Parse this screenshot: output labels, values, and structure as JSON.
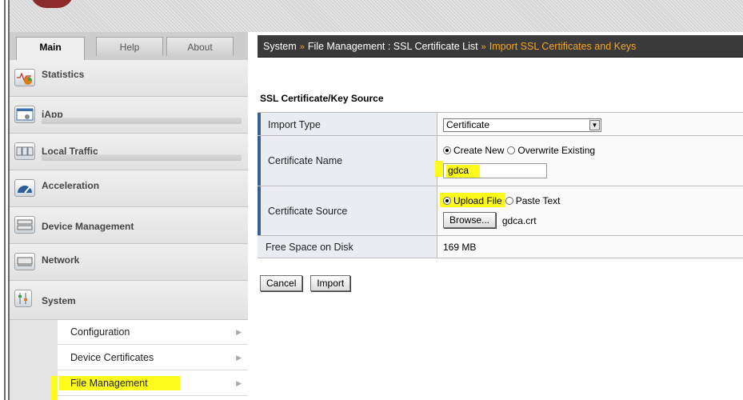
{
  "sidebar": {
    "tabs": [
      "Main",
      "Help",
      "About"
    ],
    "items": [
      {
        "label": "Statistics",
        "icon": "statistics-icon"
      },
      {
        "label": "iApp",
        "icon": "iapp-icon"
      },
      {
        "label": "Local Traffic",
        "icon": "local-traffic-icon"
      },
      {
        "label": "Acceleration",
        "icon": "acceleration-icon"
      },
      {
        "label": "Device Management",
        "icon": "device-management-icon"
      },
      {
        "label": "Network",
        "icon": "network-icon"
      },
      {
        "label": "System",
        "icon": "system-icon"
      }
    ],
    "submenu": [
      "Configuration",
      "Device Certificates",
      "File Management"
    ]
  },
  "breadcrumb": {
    "system": "System",
    "file_management": "File Management : SSL Certificate List",
    "current": "Import SSL Certificates and Keys",
    "separator": "»"
  },
  "form": {
    "section_title": "SSL Certificate/Key Source",
    "import_type_label": "Import Type",
    "import_type_value": "Certificate",
    "cert_name_label": "Certificate Name",
    "create_new": "Create New",
    "overwrite_existing": "Overwrite Existing",
    "cert_name_value": "gdca",
    "cert_source_label": "Certificate Source",
    "upload_file": "Upload File",
    "paste_text": "Paste Text",
    "browse_label": "Browse...",
    "file_name": "gdca.crt",
    "free_space_label": "Free Space on Disk",
    "free_space_value": "169 MB"
  },
  "actions": {
    "cancel": "Cancel",
    "import": "Import"
  },
  "colors": {
    "breadcrumb_bg": "#3a3a3a",
    "breadcrumb_accent": "#f5a623",
    "row_accent": "#375f8f",
    "highlight": "#fffb1a"
  }
}
